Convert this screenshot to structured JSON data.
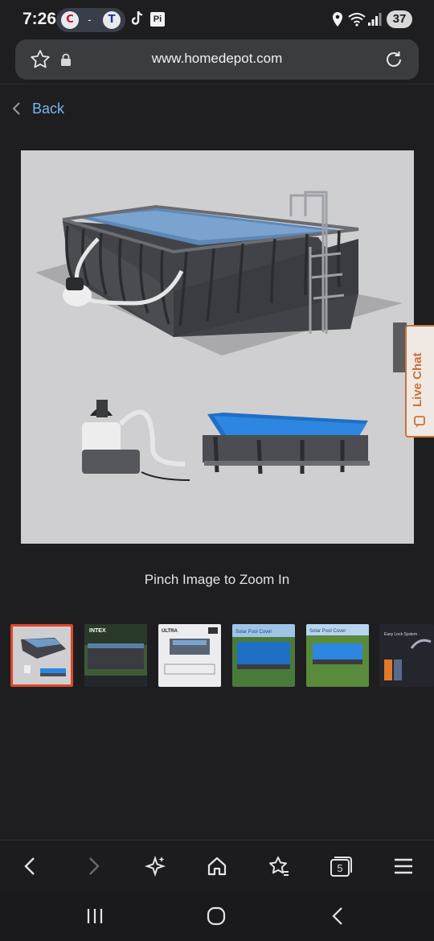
{
  "status_bar": {
    "time": "7:26",
    "score": {
      "team1_logo": "C",
      "separator": "-",
      "team2_logo": "T"
    },
    "pi_label": "Pi",
    "battery": "37",
    "icons": [
      "tiktok-icon",
      "location-icon",
      "wifi-icon",
      "signal-icon"
    ]
  },
  "browser": {
    "url": "www.homedepot.com",
    "icons": [
      "star-icon",
      "lock-icon",
      "reload-icon"
    ]
  },
  "nav": {
    "back_label": "Back"
  },
  "product": {
    "zoom_hint": "Pinch Image to Zoom In",
    "pool_brand": "INTEX",
    "thumbnails": [
      {
        "name": "thumb-1",
        "selected": true,
        "caption": ""
      },
      {
        "name": "thumb-2",
        "selected": false,
        "caption": "INTEX"
      },
      {
        "name": "thumb-3",
        "selected": false,
        "caption": "ULTRA"
      },
      {
        "name": "thumb-4",
        "selected": false,
        "caption": "Solar Pool Cover"
      },
      {
        "name": "thumb-5",
        "selected": false,
        "caption": "Solar Pool Cover"
      },
      {
        "name": "thumb-6",
        "selected": false,
        "caption": "Easy Lock System"
      }
    ]
  },
  "live_chat": {
    "label": "Live Chat"
  },
  "browser_toolbar": {
    "tab_count": "5",
    "icons": [
      "back-arrow-icon",
      "forward-arrow-icon",
      "sparkle-icon",
      "home-icon",
      "bookmarks-icon",
      "tabs-icon",
      "menu-icon"
    ]
  },
  "system_nav": {
    "icons": [
      "recents-icon",
      "home-circle-icon",
      "back-chevron-icon"
    ]
  },
  "colors": {
    "background": "#1e1e20",
    "link": "#7ab7e8",
    "accent": "#c8733a",
    "selected_border": "#e0462a"
  }
}
